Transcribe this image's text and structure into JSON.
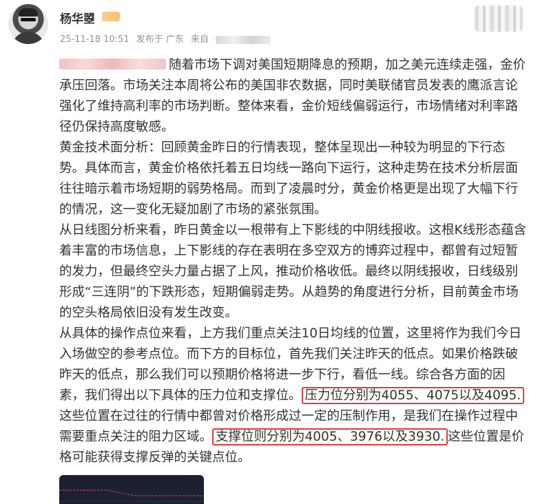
{
  "author": {
    "name": "杨华曌",
    "avatar_icon": "avatar-photo",
    "badge_icon": "vip-badge-icon"
  },
  "meta": {
    "datetime": "25-11-18 10:51",
    "posted_from": "发布于 广东",
    "source_label": "来自"
  },
  "post": {
    "paragraph1": "随着市场下调对美国短期降息的预期，加之美元连续走强，金价承压回落。市场关注本周将公布的美国非农数据，同时美联储官员发表的鹰派言论强化了维持高利率的市场判断。整体来看，金价短线偏弱运行，市场情绪对利率路径仍保持高度敏感。",
    "paragraph2": "黄金技术面分析：回顾黄金昨日的行情表现，整体呈现出一种较为明显的下行态势。具体而言，黄金价格依托着五日均线一路向下运行，这种走势在技术分析层面往往暗示着市场短期的弱势格局。而到了凌晨时分，黄金价格更是出现了大幅下行的情况，这一变化无疑加剧了市场的紧张氛围。",
    "paragraph3": "从日线图分析来看，昨日黄金以一根带有上下影线的中阴线报收。这根K线形态蕴含着丰富的市场信息，上下影线的存在表明在多空双方的博弈过程中，都曾有过短暂的发力，但最终空头力量占据了上风，推动价格收低。最终以阴线报收，日线级别形成“三连阴”的下跌形态，短期偏弱走势。从趋势的角度进行分析，目前黄金市场的空头格局依旧没有发生改变。",
    "paragraph4_start": "从具体的操作点位来看，上方我们重点关注10日均线的位置，这里将作为我们今日入场做空的参考点位。而下方的目标位，首先我们关注昨天的低点。如果价格跌破昨天的低点，那么我们可以预期价格将进一步下行，看低一线。综合各方面的因素，我们得出以下具体的压力位和支撑位。",
    "resistance_highlight": "压力位分别为4055、4075以及4095.",
    "paragraph4_middle": "这些位置在过往的行情中都曾对价格形成过一定的压制作用，是我们在操作过程中需要重点关注的阻力区域。",
    "support_highlight": "支撑位则分别为4005、3976以及3930.",
    "paragraph4_end": "这些位置是价格可能获得支撑反弹的关键点位。"
  },
  "colors": {
    "highlight_border": "#e53935",
    "meta_text": "#939393",
    "body_text": "#333333"
  },
  "attachment": {
    "icon": "chart-image-thumbnail"
  }
}
